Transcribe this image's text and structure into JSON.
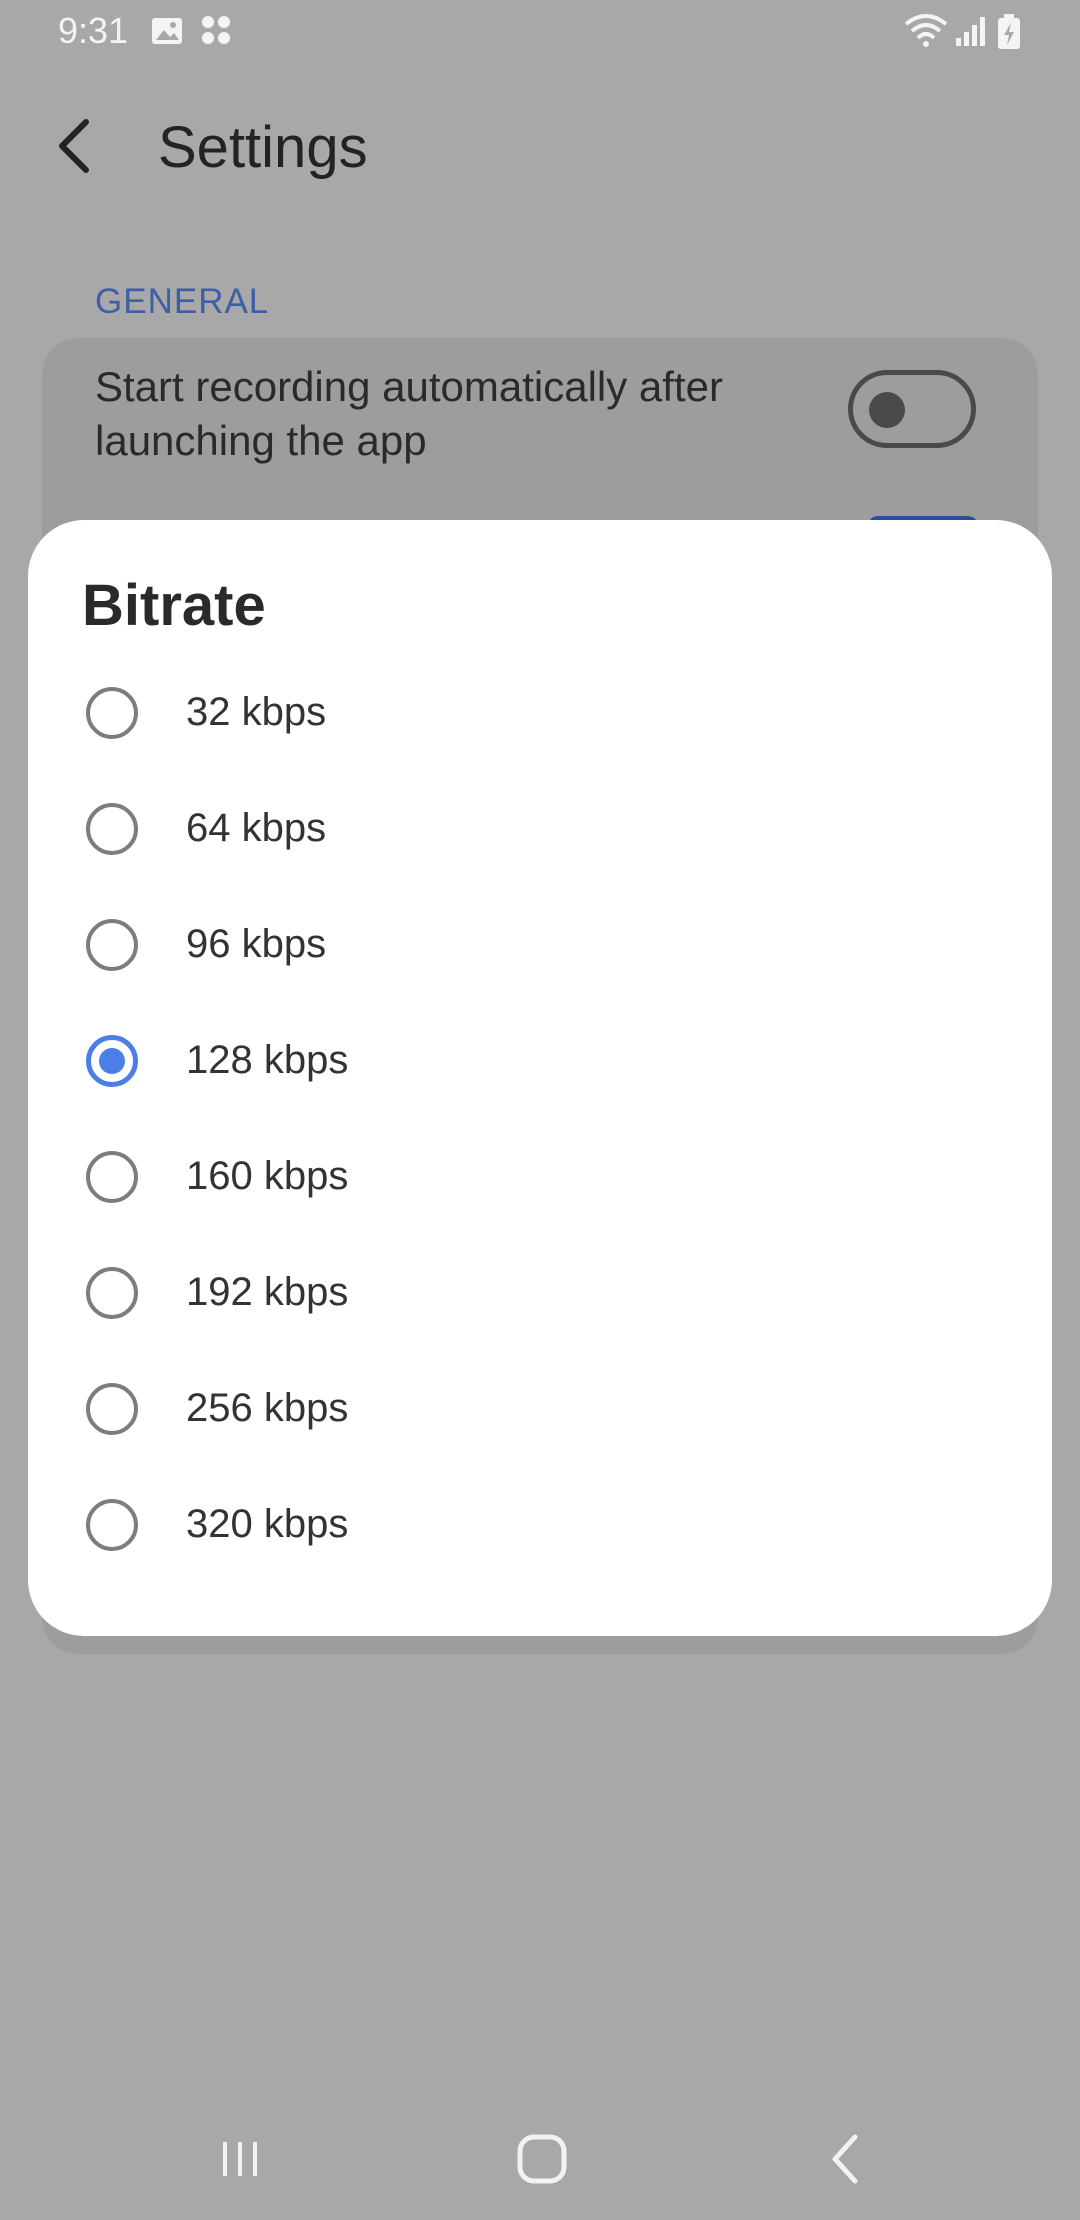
{
  "status_bar": {
    "time": "9:31",
    "icons": [
      "image-icon",
      "app-grid-icon",
      "wifi-icon",
      "signal-icon",
      "battery-charging-icon"
    ]
  },
  "header": {
    "back_icon": "back-arrow-icon",
    "title": "Settings"
  },
  "section": {
    "title": "GENERAL"
  },
  "settings": {
    "auto_record_label": "Start recording automatically after launching the app",
    "auto_record_enabled": false
  },
  "dialog": {
    "title": "Bitrate",
    "options": [
      {
        "label": "32 kbps",
        "selected": false
      },
      {
        "label": "64 kbps",
        "selected": false
      },
      {
        "label": "96 kbps",
        "selected": false
      },
      {
        "label": "128 kbps",
        "selected": true
      },
      {
        "label": "160 kbps",
        "selected": false
      },
      {
        "label": "192 kbps",
        "selected": false
      },
      {
        "label": "256 kbps",
        "selected": false
      },
      {
        "label": "320 kbps",
        "selected": false
      }
    ]
  },
  "nav_bar": {
    "icons": [
      "recent-apps-icon",
      "home-icon",
      "back-icon"
    ]
  },
  "colors": {
    "accent": "#4c7ee8",
    "section_header": "#3e5ea8",
    "scrim_background": "#a8a8a8",
    "dialog_background": "#ffffff"
  }
}
